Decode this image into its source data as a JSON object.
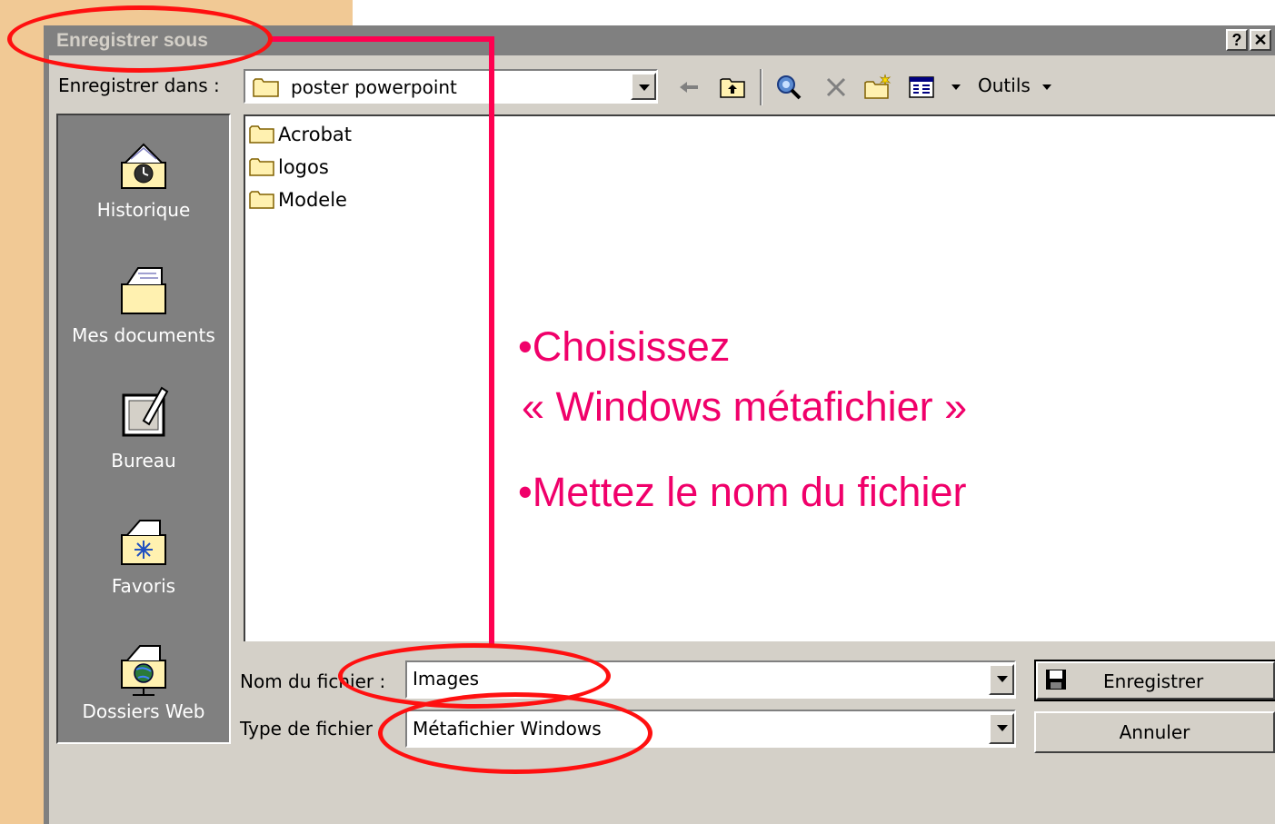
{
  "dialog": {
    "title": "Enregistrer sous",
    "help_button": "?",
    "close_button": "✕"
  },
  "save_in": {
    "label": "Enregistrer dans :",
    "value": "poster powerpoint"
  },
  "toolbar": {
    "tools_label": "Outils",
    "icons": [
      "back-arrow-icon",
      "up-folder-icon",
      "search-web-icon",
      "delete-icon",
      "new-folder-icon",
      "views-icon",
      "tools-menu-icon"
    ]
  },
  "places_bar": [
    {
      "label": "Historique",
      "icon": "history-icon"
    },
    {
      "label": "Mes documents",
      "icon": "my-documents-icon"
    },
    {
      "label": "Bureau",
      "icon": "desktop-icon"
    },
    {
      "label": "Favoris",
      "icon": "favorites-icon"
    },
    {
      "label": "Dossiers Web",
      "icon": "web-folders-icon"
    }
  ],
  "files": [
    "Acrobat",
    "logos",
    "Modele"
  ],
  "filename": {
    "label": "Nom du fichier :",
    "value": "Images"
  },
  "filetype": {
    "label": "Type de fichier :",
    "value": "Métafichier Windows"
  },
  "buttons": {
    "save": "Enregistrer",
    "cancel": "Annuler"
  },
  "annotation": {
    "line1": "•Choisissez",
    "line2": "« Windows métafichier »",
    "line3": "•Mettez le nom du fichier",
    "text_color": "#f0006a",
    "ellipse_color": "#ff1010"
  }
}
